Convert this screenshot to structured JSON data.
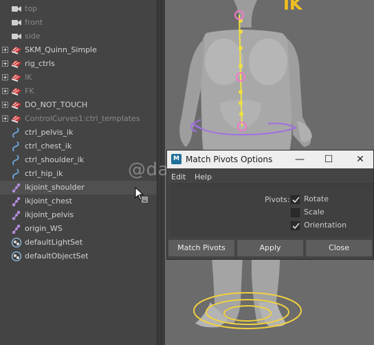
{
  "outliner": {
    "items": [
      {
        "label": "top",
        "icon": "camera-icon",
        "expander": false,
        "dim": true
      },
      {
        "label": "front",
        "icon": "camera-icon",
        "expander": false,
        "dim": true
      },
      {
        "label": "side",
        "icon": "camera-icon",
        "expander": false,
        "dim": true
      },
      {
        "label": "SKM_Quinn_Simple",
        "icon": "group-icon",
        "expander": true,
        "dim": false
      },
      {
        "label": "rig_ctrls",
        "icon": "group-icon",
        "expander": true,
        "dim": false
      },
      {
        "label": "IK",
        "icon": "group-icon",
        "expander": true,
        "dim": true
      },
      {
        "label": "FK",
        "icon": "group-icon",
        "expander": true,
        "dim": true
      },
      {
        "label": "DO_NOT_TOUCH",
        "icon": "group-icon",
        "expander": true,
        "dim": false
      },
      {
        "label": "ControlCurves1:ctrl_templates",
        "icon": "group-icon",
        "expander": true,
        "dim": true
      },
      {
        "label": "ctrl_pelvis_ik",
        "icon": "curve-icon",
        "expander": false,
        "dim": false
      },
      {
        "label": "ctrl_chest_ik",
        "icon": "curve-icon",
        "expander": false,
        "dim": false
      },
      {
        "label": "ctrl_shoulder_ik",
        "icon": "curve-icon",
        "expander": false,
        "dim": false
      },
      {
        "label": "ctrl_hip_ik",
        "icon": "curve-icon",
        "expander": false,
        "dim": false
      },
      {
        "label": "ikjoint_shoulder",
        "icon": "joint-icon",
        "expander": false,
        "dim": false,
        "selected": true
      },
      {
        "label": "ikjoint_chest",
        "icon": "joint-icon",
        "expander": false,
        "dim": false
      },
      {
        "label": "ikjoint_pelvis",
        "icon": "joint-icon",
        "expander": false,
        "dim": false
      },
      {
        "label": "origin_WS",
        "icon": "joint-icon",
        "expander": false,
        "dim": false
      },
      {
        "label": "defaultLightSet",
        "icon": "set-icon",
        "expander": false,
        "dim": false
      },
      {
        "label": "defaultObjectSet",
        "icon": "set-icon",
        "expander": false,
        "dim": false
      }
    ]
  },
  "viewport": {
    "overlay_text": "IK"
  },
  "watermark": "@dawn_arc",
  "dialog": {
    "title": "Match Pivots Options",
    "logo_text": "M",
    "controls": {
      "minimize": "—",
      "maximize": "☐",
      "close": "✕"
    },
    "menus": {
      "edit": "Edit",
      "help": "Help"
    },
    "pivots_label": "Pivots:",
    "options": [
      {
        "label": "Rotate",
        "checked": true
      },
      {
        "label": "Scale",
        "checked": false
      },
      {
        "label": "Orientation",
        "checked": true
      }
    ],
    "buttons": {
      "match": "Match Pivots",
      "apply": "Apply",
      "close": "Close"
    }
  },
  "colors": {
    "joint": "#f178c8",
    "ik_handle": "#f0e040",
    "control_curve": "#a070e0",
    "ground_rings": "#f0d040"
  }
}
